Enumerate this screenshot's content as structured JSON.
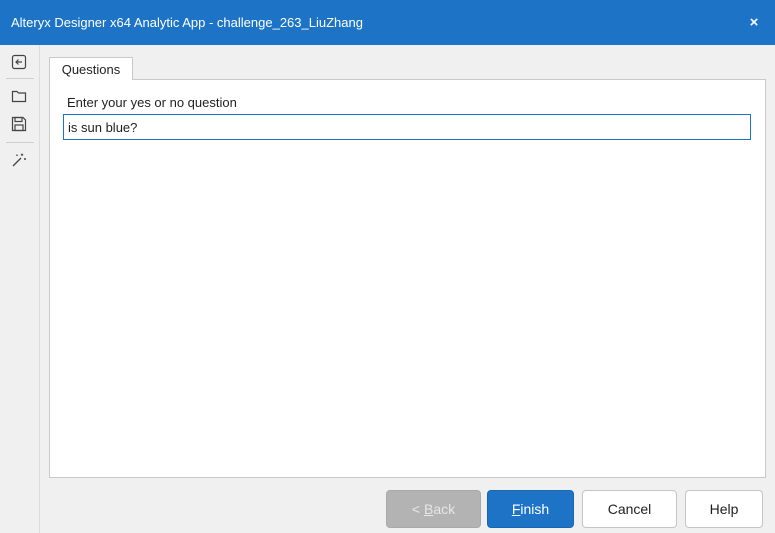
{
  "window": {
    "title": "Alteryx Designer x64 Analytic App - challenge_263_LiuZhang",
    "close_label": "×",
    "accent_color": "#1d74c7"
  },
  "sidebar": {
    "icons": [
      "exit-panel-icon",
      "folder-icon",
      "save-icon",
      "magic-wand-icon"
    ]
  },
  "tabs": [
    {
      "label": "Questions",
      "selected": true
    }
  ],
  "form": {
    "question_label": "Enter your yes or no question",
    "question_value": "is sun blue?"
  },
  "buttons": {
    "back_prefix": "< ",
    "back_accel": "B",
    "back_rest": "ack",
    "finish_accel": "F",
    "finish_rest": "inish",
    "cancel_label": "Cancel",
    "help_label": "Help"
  }
}
